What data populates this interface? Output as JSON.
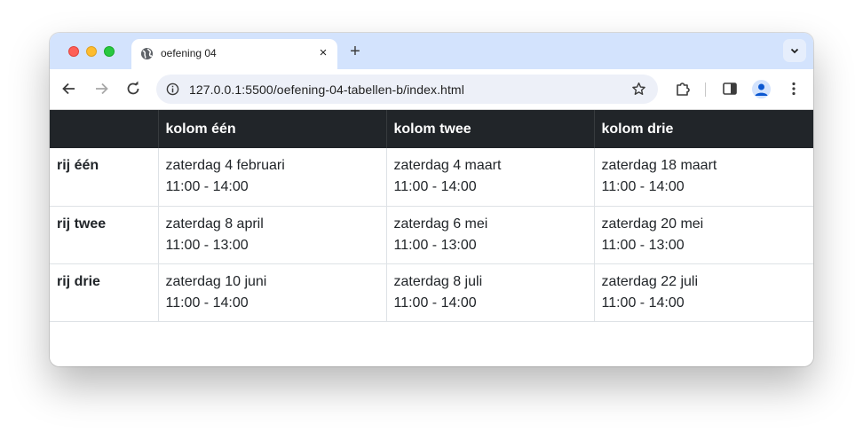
{
  "browser": {
    "tab_title": "oefening 04",
    "tab_close": "×",
    "new_tab": "+",
    "url": "127.0.0.1:5500/oefening-04-tabellen-b/index.html"
  },
  "table": {
    "headers": [
      "",
      "kolom één",
      "kolom twee",
      "kolom drie"
    ],
    "rows": [
      {
        "label": "rij één",
        "cells": [
          {
            "date": "zaterdag 4 februari",
            "time": "11:00 - 14:00"
          },
          {
            "date": "zaterdag 4 maart",
            "time": "11:00 - 14:00"
          },
          {
            "date": "zaterdag 18 maart",
            "time": "11:00 - 14:00"
          }
        ]
      },
      {
        "label": "rij twee",
        "cells": [
          {
            "date": "zaterdag 8 april",
            "time": "11:00 - 13:00"
          },
          {
            "date": "zaterdag 6 mei",
            "time": "11:00 - 13:00"
          },
          {
            "date": "zaterdag 20 mei",
            "time": "11:00 - 13:00"
          }
        ]
      },
      {
        "label": "rij drie",
        "cells": [
          {
            "date": "zaterdag 10 juni",
            "time": "11:00 - 14:00"
          },
          {
            "date": "zaterdag 8 juli",
            "time": "11:00 - 14:00"
          },
          {
            "date": "zaterdag 22 juli",
            "time": "11:00 - 14:00"
          }
        ]
      }
    ]
  },
  "colors": {
    "tabstrip": "#d3e3fd",
    "table_header_bg": "#212529",
    "table_header_text": "#ffffff",
    "border": "#dee2e6"
  },
  "icons": {
    "tab_favicon": "globe-icon",
    "back": "arrow-left-icon",
    "forward": "arrow-right-icon",
    "reload": "reload-icon",
    "site_info": "info-icon",
    "bookmark": "star-icon",
    "extensions": "puzzle-icon",
    "side_panel": "side-panel-icon",
    "profile": "profile-icon",
    "menu": "kebab-menu-icon",
    "tab_search": "chevron-down-icon"
  }
}
